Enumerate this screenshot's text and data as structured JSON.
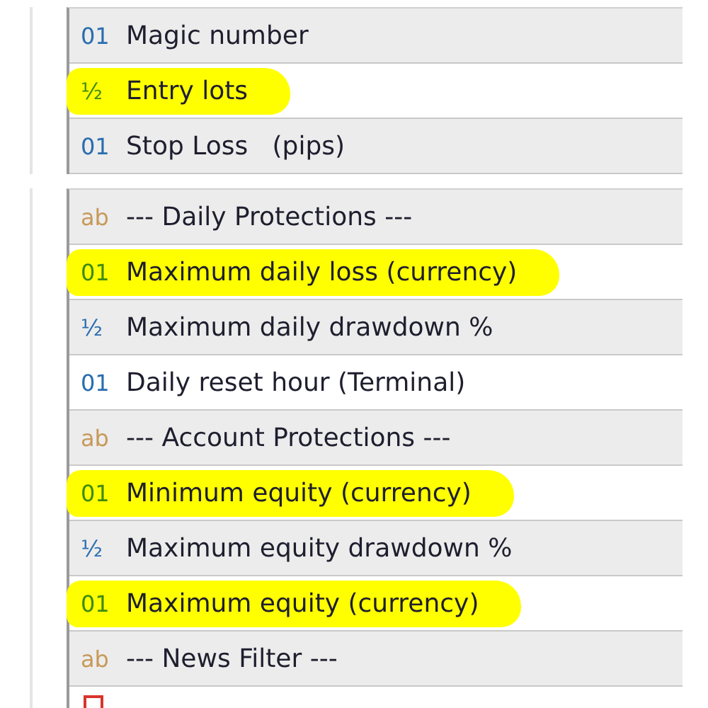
{
  "panels": [
    {
      "rows": [
        {
          "kind": "int",
          "icon": "01",
          "label": "Magic number",
          "highlighted": false
        },
        {
          "kind": "double",
          "icon": "½",
          "label": "Entry lots",
          "highlighted": true
        },
        {
          "kind": "int",
          "icon": "01",
          "label": "Stop Loss   (pips)",
          "highlighted": false
        }
      ]
    },
    {
      "rows": [
        {
          "kind": "string",
          "icon": "ab",
          "label": "--- Daily Protections ---",
          "highlighted": false
        },
        {
          "kind": "int",
          "icon": "01",
          "label": "Maximum daily loss (currency)",
          "highlighted": true
        },
        {
          "kind": "double",
          "icon": "½",
          "label": "Maximum daily drawdown %",
          "highlighted": false
        },
        {
          "kind": "int",
          "icon": "01",
          "label": "Daily reset hour (Terminal)",
          "highlighted": false
        },
        {
          "kind": "string",
          "icon": "ab",
          "label": "--- Account Protections ---",
          "highlighted": false
        },
        {
          "kind": "int",
          "icon": "01",
          "label": "Minimum equity (currency)",
          "highlighted": true
        },
        {
          "kind": "double",
          "icon": "½",
          "label": "Maximum equity drawdown %",
          "highlighted": false
        },
        {
          "kind": "int",
          "icon": "01",
          "label": "Maximum equity (currency)",
          "highlighted": true
        },
        {
          "kind": "string",
          "icon": "ab",
          "label": "--- News Filter ---",
          "highlighted": false
        },
        {
          "kind": "list"
        }
      ]
    }
  ]
}
